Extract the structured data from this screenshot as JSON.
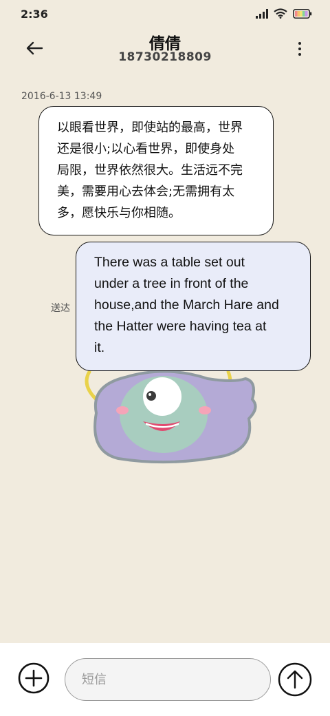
{
  "status_bar": {
    "time": "2:36",
    "icons": [
      "signal-icon",
      "wifi-icon",
      "battery-icon"
    ]
  },
  "header": {
    "contact_name": "倩倩",
    "contact_number": "18730218809",
    "back_icon": "arrow-left-icon",
    "more_icon": "more-vertical-icon"
  },
  "conversation": {
    "timestamp": "2016-6-13 13:49",
    "messages": [
      {
        "direction": "incoming",
        "lines": [
          "以眼看世界，即使站的最高，世界",
          "还是很小;以心看世界，即使身处",
          "局限，世界依然很大。生活远不完",
          "美，需要用心去体会;无需拥有太",
          "多，愿快乐与你相随。"
        ]
      },
      {
        "direction": "outgoing",
        "lines": [
          "There was a table set out",
          "under a tree in front of the",
          "house,and the March Hare and",
          "the Hatter were having tea at",
          "it."
        ],
        "status": "送达"
      }
    ]
  },
  "input_bar": {
    "placeholder": "短信",
    "add_icon": "plus-circle-icon",
    "send_icon": "send-arrow-up-icon"
  },
  "colors": {
    "background": "#f1ebde",
    "incoming_bubble": "#ffffff",
    "outgoing_bubble": "#e9ecf9",
    "bubble_border": "#111111"
  }
}
